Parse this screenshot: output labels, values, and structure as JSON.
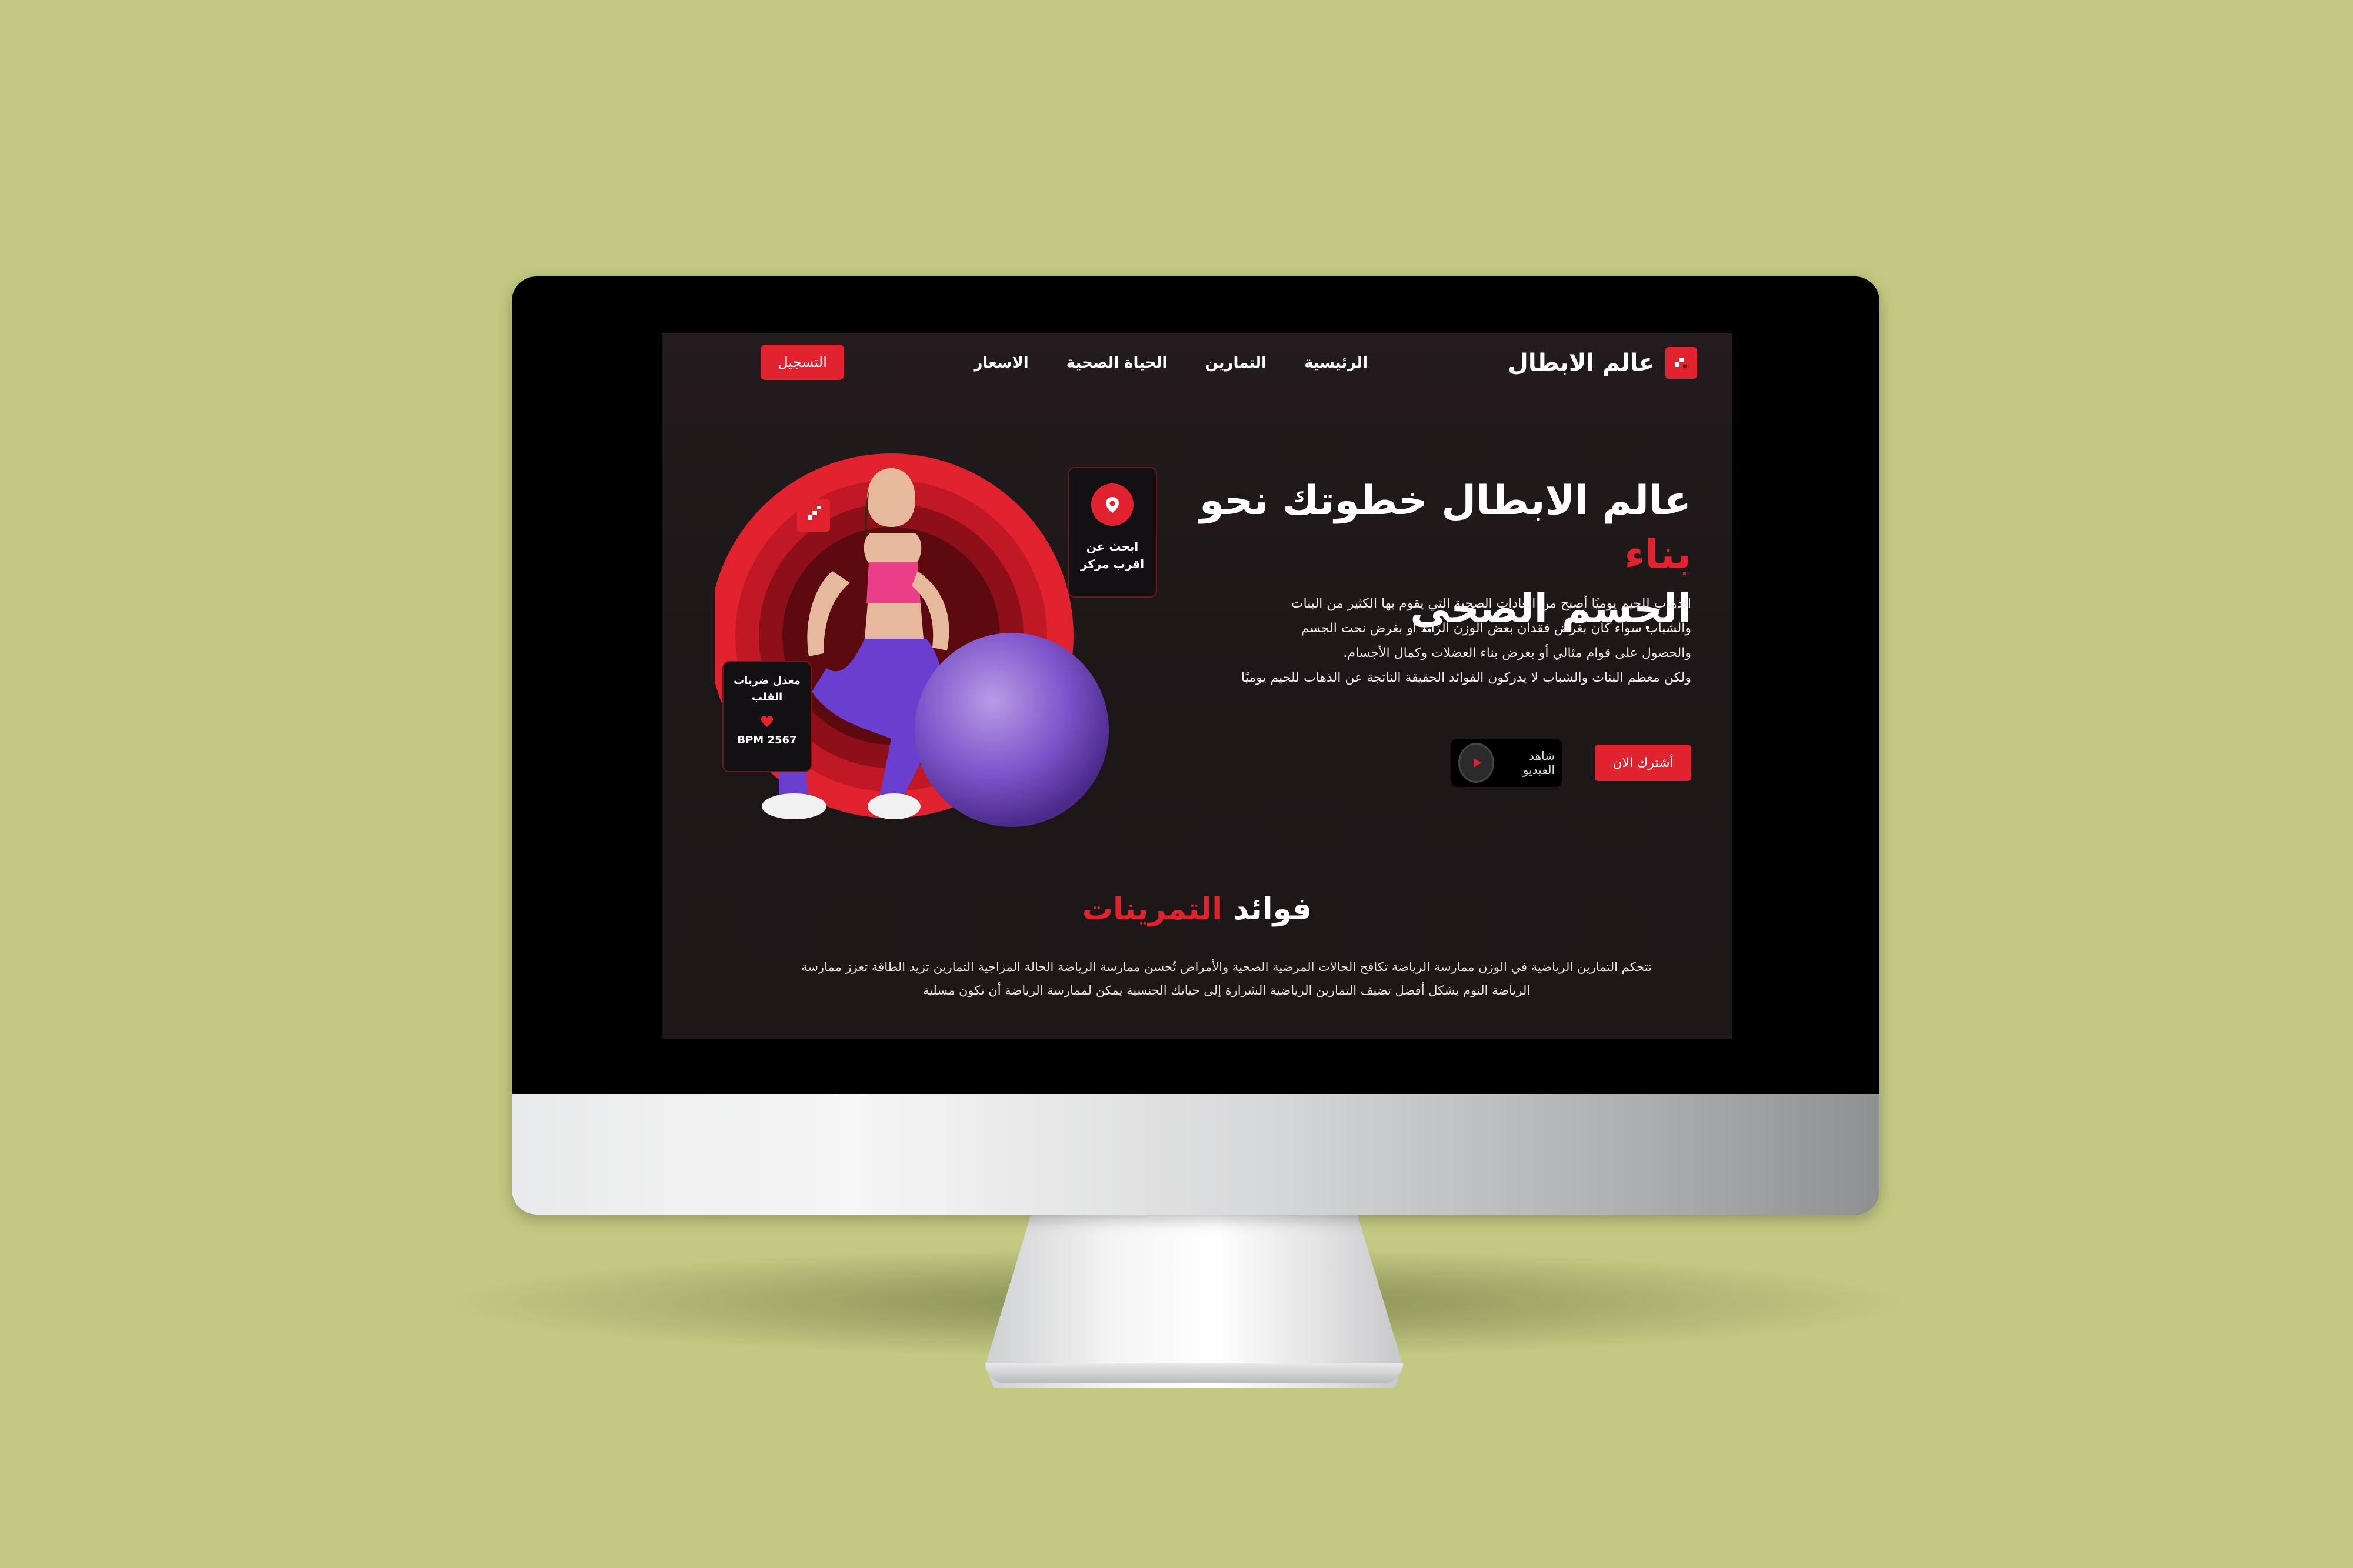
{
  "brand": {
    "name": "عالم الابطال",
    "accent": "#e0232f",
    "background": "#c3c982"
  },
  "nav": {
    "items": [
      "الرئيسية",
      "التمارين",
      "الحياة الصحية",
      "الاسعار"
    ],
    "register_label": "التسجيل"
  },
  "hero": {
    "title_part1": "عالم الابطال خطوتك نحو ",
    "title_highlight": "بناء",
    "title_part2": "الجسم الصحي",
    "paragraph": [
      "الذهاب للجيم يوميًا أصبح من العادات الصحية التي يقوم بها الكثير من البنات",
      "والشباب سواء كان بغرض فقدان بعض الوزن الزائد أو بغرض نحت الجسم",
      "والحصول على قوام مثالي أو بغرض بناء العضلات وكمال الأجسام.",
      "ولكن معظم البنات والشباب لا يدركون الفوائد الحقيقة الناتجة عن الذهاب للجيم يوميًا"
    ],
    "subscribe_label": "أشترك الان",
    "video_label": "شاهد الفيديو"
  },
  "cards": {
    "location": {
      "line1": "ابحث عن",
      "line2": "اقرب مركز"
    },
    "heart": {
      "line1": "معدل ضربات",
      "line2": "القلب",
      "value": "BPM 2567"
    }
  },
  "benefits": {
    "title_part1": "فوائد ",
    "title_highlight": "التمرينات",
    "text_line1": "تتحكم التمارين الرياضية في الوزن ممارسة الرياضة تكافح الحالات المرضية الصحية والأمراض تُحسن ممارسة الرياضة الحالة المزاجية التمارين تزيد الطاقة تعزز ممارسة",
    "text_line2": "الرياضة النوم بشكل أفضل تضيف التمارين الرياضية الشرارة إلى حياتك الجنسية يمكن لممارسة الرياضة أن تكون مسلية"
  },
  "icons": [
    "logo-icon",
    "location-pin-icon",
    "heart-icon",
    "play-icon",
    "dumbbell-badge-icon"
  ]
}
